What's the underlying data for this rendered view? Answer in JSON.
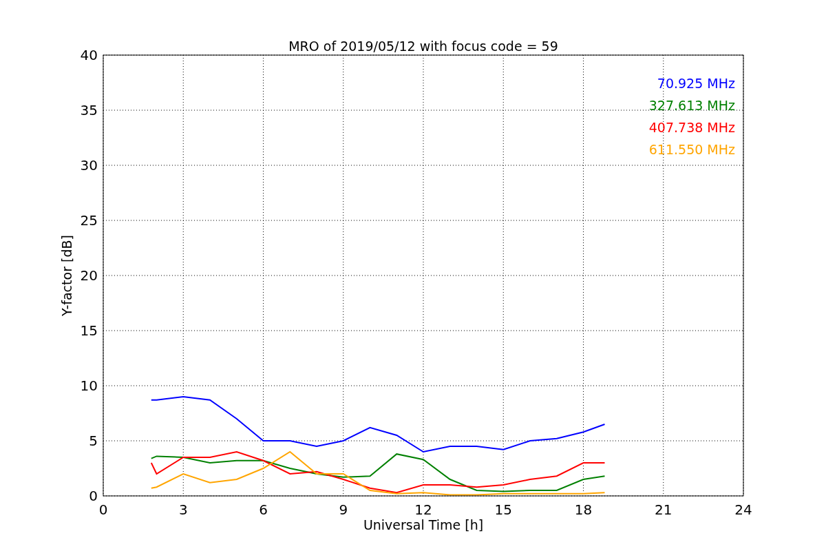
{
  "chart_data": {
    "type": "line",
    "title": "MRO of 2019/05/12 with focus code = 59",
    "xlabel": "Universal Time [h]",
    "ylabel": "Y-factor [dB]",
    "x": [
      1.8,
      2,
      3,
      4,
      5,
      6,
      7,
      8,
      9,
      10,
      11,
      12,
      13,
      14,
      15,
      16,
      17,
      18,
      18.8
    ],
    "series": [
      {
        "name": "70.925 MHz",
        "color": "#0000ff",
        "values": [
          8.7,
          8.7,
          9.0,
          8.7,
          7.0,
          5.0,
          5.0,
          4.5,
          5.0,
          6.2,
          5.5,
          4.0,
          4.5,
          4.5,
          4.2,
          5.0,
          5.2,
          5.8,
          6.5
        ]
      },
      {
        "name": "327.613 MHz",
        "color": "#008000",
        "values": [
          3.4,
          3.6,
          3.5,
          3.0,
          3.2,
          3.2,
          2.5,
          2.0,
          1.7,
          1.8,
          3.8,
          3.3,
          1.5,
          0.5,
          0.4,
          0.5,
          0.5,
          1.5,
          1.8
        ]
      },
      {
        "name": "407.738 MHz",
        "color": "#ff0000",
        "values": [
          3.0,
          2.0,
          3.5,
          3.5,
          4.0,
          3.2,
          2.0,
          2.2,
          1.5,
          0.7,
          0.3,
          1.0,
          1.0,
          0.8,
          1.0,
          1.5,
          1.8,
          3.0,
          3.0
        ]
      },
      {
        "name": "611.550 MHz",
        "color": "#ffa500",
        "values": [
          0.7,
          0.8,
          2.0,
          1.2,
          1.5,
          2.5,
          4.0,
          2.0,
          2.0,
          0.5,
          0.2,
          0.3,
          0.1,
          0.1,
          0.2,
          0.2,
          0.2,
          0.2,
          0.3
        ]
      }
    ],
    "xlim": [
      0,
      24
    ],
    "ylim": [
      0,
      40
    ],
    "xticks": [
      0,
      3,
      6,
      9,
      12,
      15,
      18,
      21,
      24
    ],
    "yticks": [
      0,
      5,
      10,
      15,
      20,
      25,
      30,
      35,
      40
    ],
    "grid": true
  }
}
